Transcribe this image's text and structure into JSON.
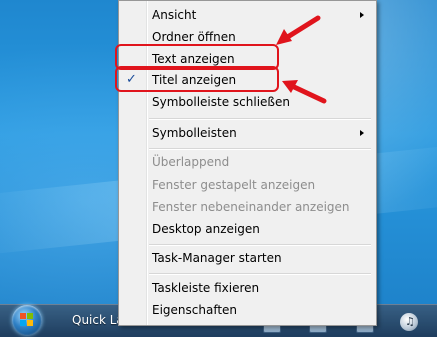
{
  "taskbar": {
    "quicklaunch_label": "Quick Launch"
  },
  "menu": {
    "items": [
      {
        "label": "Ansicht",
        "submenu": true,
        "disabled": false,
        "checked": false
      },
      {
        "label": "Ordner öffnen",
        "submenu": false,
        "disabled": false,
        "checked": false
      },
      {
        "label": "Text anzeigen",
        "submenu": false,
        "disabled": false,
        "checked": false
      },
      {
        "label": "Titel anzeigen",
        "submenu": false,
        "disabled": false,
        "checked": true
      },
      {
        "label": "Symbolleiste schließen",
        "submenu": false,
        "disabled": false,
        "checked": false
      },
      {
        "label": "Symbolleisten",
        "submenu": true,
        "disabled": false,
        "checked": false
      },
      {
        "label": "Überlappend",
        "submenu": false,
        "disabled": true,
        "checked": false
      },
      {
        "label": "Fenster gestapelt anzeigen",
        "submenu": false,
        "disabled": true,
        "checked": false
      },
      {
        "label": "Fenster nebeneinander anzeigen",
        "submenu": false,
        "disabled": true,
        "checked": false
      },
      {
        "label": "Desktop anzeigen",
        "submenu": false,
        "disabled": false,
        "checked": false
      },
      {
        "label": "Task-Manager starten",
        "submenu": false,
        "disabled": false,
        "checked": false
      },
      {
        "label": "Taskleiste fixieren",
        "submenu": false,
        "disabled": false,
        "checked": false
      },
      {
        "label": "Eigenschaften",
        "submenu": false,
        "disabled": false,
        "checked": false
      }
    ],
    "check_glyph": "✓"
  },
  "annotations": {
    "highlight_color": "#e0141c"
  }
}
